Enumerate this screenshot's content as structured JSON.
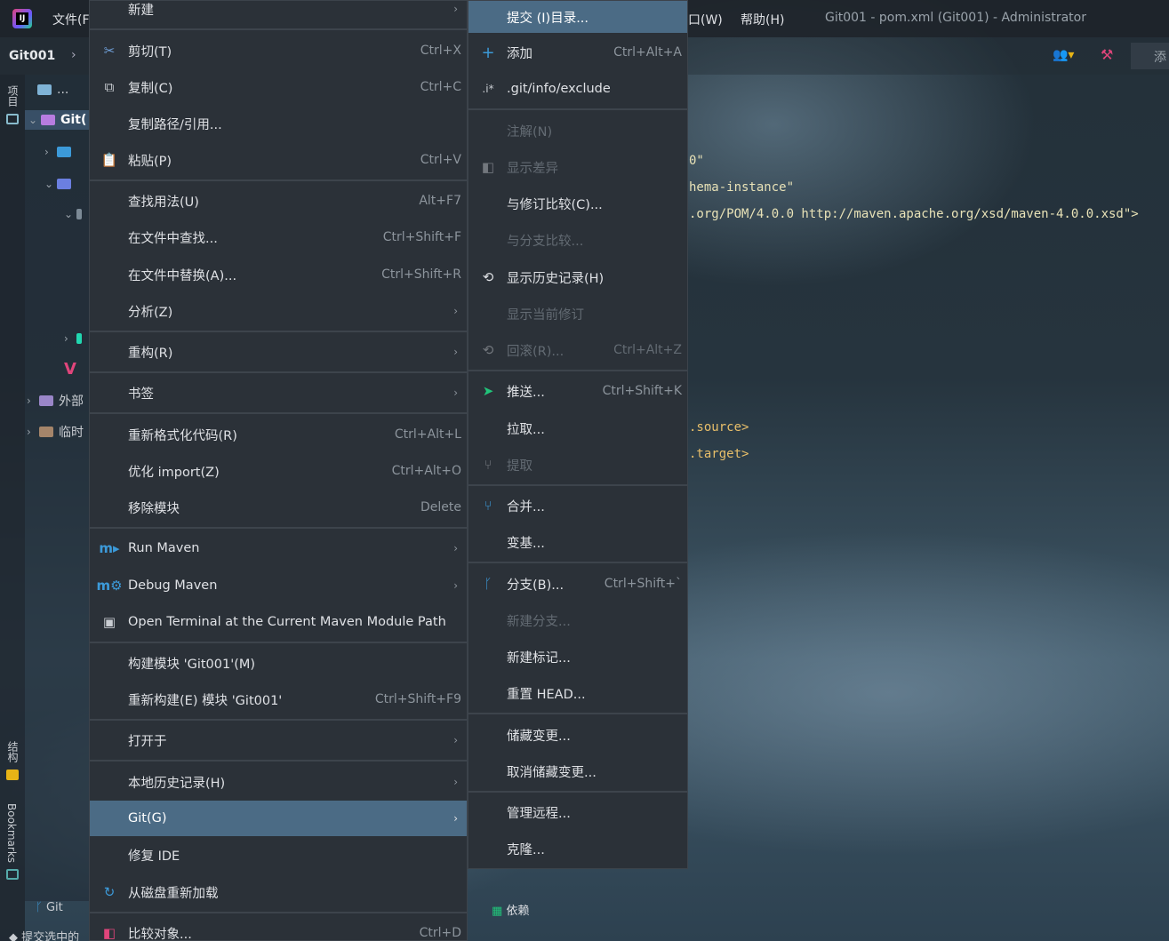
{
  "titlebar": {
    "menu_file": "文件(F",
    "menu_window": "口(W)",
    "menu_help": "帮助(H)",
    "window_title": "Git001 - pom.xml (Git001) - Administrator"
  },
  "project": {
    "name": "Git001",
    "tree_ellipsis": "...",
    "root_label": "Git(",
    "external_label": "外部",
    "scratch_label": "临时"
  },
  "left_strip": {
    "project_tab": "项目",
    "structure_tab": "结构",
    "bookmarks_tab": "Bookmarks"
  },
  "toolbar": {
    "add_label": "添"
  },
  "code_lines": [
    "0\"",
    "hema-instance\"",
    ".org/POM/4.0.0 http://maven.apache.org/xsd/maven-4.0.0.xsd\">",
    ".source>",
    ".target>"
  ],
  "bottom": {
    "git_tab": "Git",
    "commit_label": "提交选中的",
    "dependencies_label": "依赖"
  },
  "context_menu": {
    "new": {
      "label": "新建"
    },
    "cut": {
      "label": "剪切(T)",
      "shortcut": "Ctrl+X"
    },
    "copy": {
      "label": "复制(C)",
      "shortcut": "Ctrl+C"
    },
    "copy_path": {
      "label": "复制路径/引用..."
    },
    "paste": {
      "label": "粘贴(P)",
      "shortcut": "Ctrl+V"
    },
    "find_usages": {
      "label": "查找用法(U)",
      "shortcut": "Alt+F7"
    },
    "find_in_files": {
      "label": "在文件中查找...",
      "shortcut": "Ctrl+Shift+F"
    },
    "replace_in_files": {
      "label": "在文件中替换(A)...",
      "shortcut": "Ctrl+Shift+R"
    },
    "analyze": {
      "label": "分析(Z)"
    },
    "refactor": {
      "label": "重构(R)"
    },
    "bookmarks": {
      "label": "书签"
    },
    "reformat": {
      "label": "重新格式化代码(R)",
      "shortcut": "Ctrl+Alt+L"
    },
    "optimize_imports": {
      "label": "优化 import(Z)",
      "shortcut": "Ctrl+Alt+O"
    },
    "remove_module": {
      "label": "移除模块",
      "shortcut": "Delete"
    },
    "run_maven": {
      "label": "Run Maven"
    },
    "debug_maven": {
      "label": "Debug Maven"
    },
    "open_terminal": {
      "label": "Open Terminal at the Current Maven Module Path"
    },
    "build_module": {
      "label": "构建模块 'Git001'(M)"
    },
    "rebuild_module": {
      "label": "重新构建(E) 模块 'Git001'",
      "shortcut": "Ctrl+Shift+F9"
    },
    "open_in": {
      "label": "打开于"
    },
    "local_history": {
      "label": "本地历史记录(H)"
    },
    "git": {
      "label": "Git(G)"
    },
    "repair_ide": {
      "label": "修复 IDE"
    },
    "reload_from_disk": {
      "label": "从磁盘重新加载"
    },
    "compare_with": {
      "label": "比较对象...",
      "shortcut": "Ctrl+D"
    }
  },
  "git_menu": {
    "commit_dir": {
      "label": "提交 (I)目录..."
    },
    "add": {
      "label": "添加",
      "shortcut": "Ctrl+Alt+A"
    },
    "exclude": {
      "label": ".git/info/exclude"
    },
    "annotate": {
      "label": "注解(N)"
    },
    "show_diff": {
      "label": "显示差异"
    },
    "compare_revision": {
      "label": "与修订比较(C)..."
    },
    "compare_branch": {
      "label": "与分支比较..."
    },
    "show_history": {
      "label": "显示历史记录(H)"
    },
    "show_current_revision": {
      "label": "显示当前修订"
    },
    "rollback": {
      "label": "回滚(R)...",
      "shortcut": "Ctrl+Alt+Z"
    },
    "push": {
      "label": "推送...",
      "shortcut": "Ctrl+Shift+K"
    },
    "pull": {
      "label": "拉取..."
    },
    "fetch": {
      "label": "提取"
    },
    "merge": {
      "label": "合并..."
    },
    "rebase": {
      "label": "变基..."
    },
    "branches": {
      "label": "分支(B)...",
      "shortcut": "Ctrl+Shift+`"
    },
    "new_branch": {
      "label": "新建分支..."
    },
    "new_tag": {
      "label": "新建标记..."
    },
    "reset_head": {
      "label": "重置 HEAD..."
    },
    "stash": {
      "label": "储藏变更..."
    },
    "unstash": {
      "label": "取消储藏变更..."
    },
    "manage_remotes": {
      "label": "管理远程..."
    },
    "clone": {
      "label": "克隆..."
    }
  },
  "colors": {
    "menu_bg": "#2b3138",
    "highlight": "#4b6b85",
    "disabled_text": "#636b73",
    "accent_green": "#21c47a",
    "accent_blue": "#3c9ad9"
  }
}
